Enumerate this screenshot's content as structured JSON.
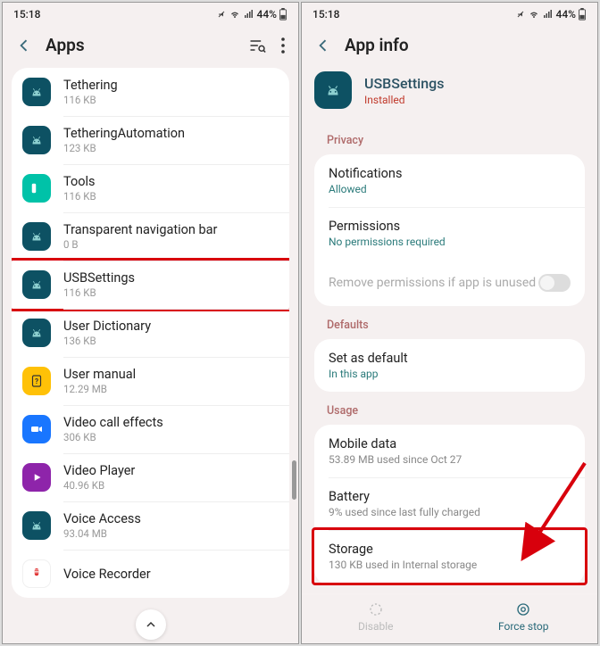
{
  "status": {
    "time": "15:18",
    "battery": "44%"
  },
  "left": {
    "title": "Apps",
    "apps": [
      {
        "name": "Tethering",
        "sub": "116 KB",
        "icon": "android"
      },
      {
        "name": "TetheringAutomation",
        "sub": "123 KB",
        "icon": "android"
      },
      {
        "name": "Tools",
        "sub": "116 KB",
        "icon": "tools"
      },
      {
        "name": "Transparent navigation bar",
        "sub": "0 B",
        "icon": "android"
      },
      {
        "name": "USBSettings",
        "sub": "116 KB",
        "icon": "android",
        "highlight": true
      },
      {
        "name": "User Dictionary",
        "sub": "136 KB",
        "icon": "android"
      },
      {
        "name": "User manual",
        "sub": "12.29 MB",
        "icon": "manual"
      },
      {
        "name": "Video call effects",
        "sub": "306 KB",
        "icon": "video-call"
      },
      {
        "name": "Video Player",
        "sub": "40.96 KB",
        "icon": "play"
      },
      {
        "name": "Voice Access",
        "sub": "93.04 MB",
        "icon": "android"
      },
      {
        "name": "Voice Recorder",
        "sub": "",
        "icon": "recorder"
      }
    ]
  },
  "right": {
    "title": "App info",
    "app": {
      "name": "USBSettings",
      "status": "Installed"
    },
    "sections": {
      "privacy": {
        "label": "Privacy",
        "rows": [
          {
            "title": "Notifications",
            "sub": "Allowed",
            "subColor": "teal"
          },
          {
            "title": "Permissions",
            "sub": "No permissions required",
            "subColor": "teal"
          }
        ],
        "toggle_label": "Remove permissions if app is unused"
      },
      "defaults": {
        "label": "Defaults",
        "rows": [
          {
            "title": "Set as default",
            "sub": "In this app",
            "subColor": "teal"
          }
        ]
      },
      "usage": {
        "label": "Usage",
        "rows": [
          {
            "title": "Mobile data",
            "sub": "53.89 MB used since Oct 27",
            "subColor": "gray"
          },
          {
            "title": "Battery",
            "sub": "9% used since last fully charged",
            "subColor": "gray"
          },
          {
            "title": "Storage",
            "sub": "130 KB used in Internal storage",
            "subColor": "gray",
            "highlight": true
          }
        ]
      }
    },
    "buttons": {
      "disable": "Disable",
      "force_stop": "Force stop"
    }
  }
}
